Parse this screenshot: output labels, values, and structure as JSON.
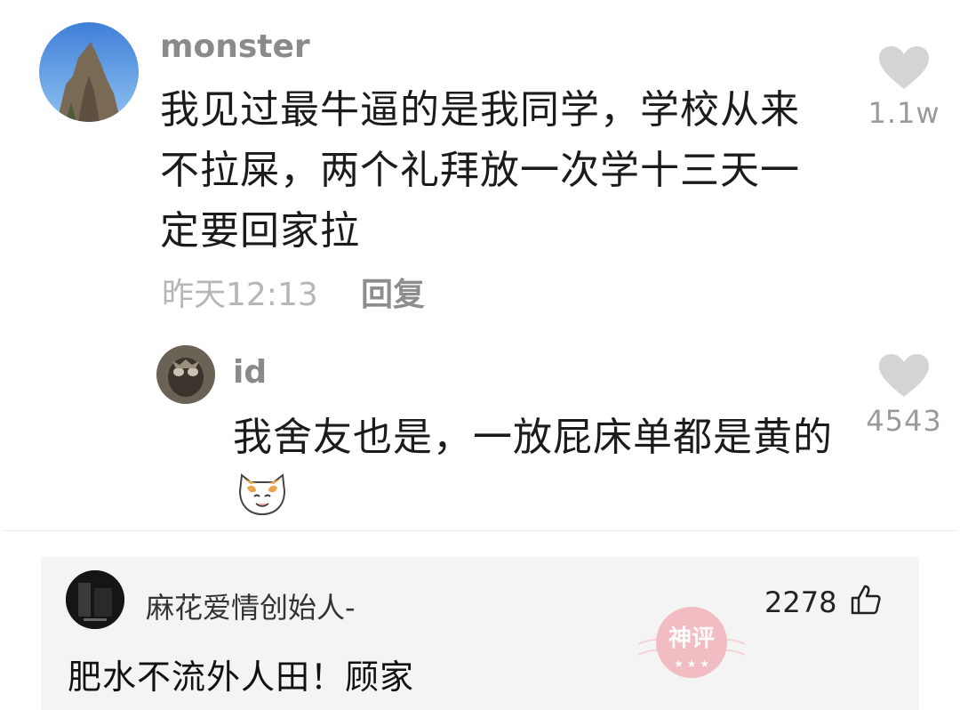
{
  "main_comment": {
    "username": "monster",
    "text_lines": [
      "我见过最牛逼的是我同学，学校从来",
      "不拉屎，两个礼拜放一次学十三天一",
      "定要回家拉"
    ],
    "time": "昨天12:13",
    "reply_label": "回复",
    "like_count": "1.1w",
    "like_icon": "heart-icon"
  },
  "reply_comment": {
    "username": "id",
    "text": "我舍友也是，一放屁床单都是黄的",
    "like_count": "4543",
    "like_icon": "heart-icon",
    "emoji": "cat-face-icon"
  },
  "bottom_comment": {
    "username": "麻花爱情创始人-",
    "like_count": "2278",
    "like_icon": "thumbs-up-icon",
    "text": "肥水不流外人田！顾家",
    "stamp_text": "神评"
  },
  "colors": {
    "username_gray": "#8a8a8a",
    "timestamp_gray": "#b6b6b6",
    "card_bg": "#f4f4f4",
    "stamp_pink": "#f2a0a8"
  }
}
